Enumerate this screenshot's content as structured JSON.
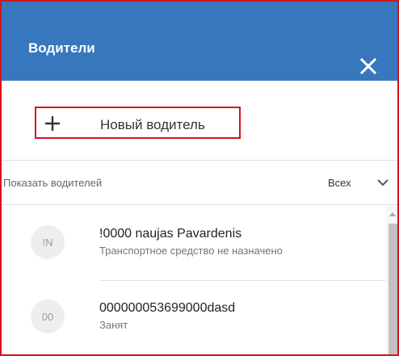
{
  "header": {
    "title": "Водители",
    "close_icon": "close-icon",
    "background": "#3777bd"
  },
  "add_driver": {
    "icon": "plus-icon",
    "label": "Новый водитель"
  },
  "filter": {
    "label": "Показать водителей",
    "selected": "Всех",
    "icon": "chevron-down-icon"
  },
  "drivers": [
    {
      "initials": "!N",
      "name": "!0000 naujas Pavardenis",
      "status": "Транспортное средство не назначено"
    },
    {
      "initials": "00",
      "name": "000000053699000dasd",
      "status": "Занят"
    }
  ],
  "colors": {
    "accent": "#3777bd",
    "highlight": "#d6121c"
  }
}
